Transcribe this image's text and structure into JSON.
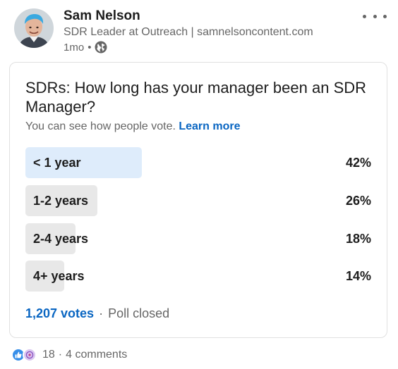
{
  "post": {
    "author_name": "Sam Nelson",
    "author_headline": "SDR Leader at Outreach | samnelsoncontent.com",
    "time_ago": "1mo",
    "separator": "•"
  },
  "poll": {
    "question": "SDRs: How long has your manager been an SDR Manager?",
    "subtitle": "You can see how people vote.",
    "learn_more": "Learn more",
    "options": [
      {
        "label": "< 1 year",
        "percent": "42%",
        "share": 0.42,
        "selected": true
      },
      {
        "label": "1-2 years",
        "percent": "26%",
        "share": 0.26,
        "selected": false
      },
      {
        "label": "2-4 years",
        "percent": "18%",
        "share": 0.18,
        "selected": false
      },
      {
        "label": "4+ years",
        "percent": "14%",
        "share": 0.14,
        "selected": false
      }
    ],
    "votes": "1,207 votes",
    "separator": "·",
    "status": "Poll closed"
  },
  "social": {
    "reaction_count": "18",
    "separator": "·",
    "comments": "4 comments",
    "reactions": [
      "like-icon",
      "love-icon"
    ]
  },
  "colors": {
    "link": "#0a66c2",
    "selected_bar": "#deecfb",
    "bar": "#e8e8e8",
    "secondary_text": "#666666"
  }
}
